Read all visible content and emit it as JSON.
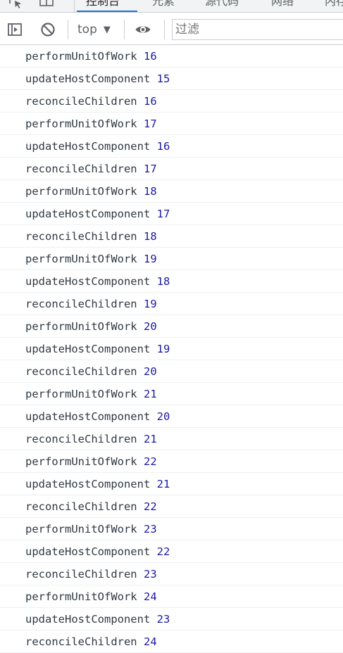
{
  "devtools": {
    "tabs": [
      {
        "label": "控制台",
        "active": true
      },
      {
        "label": "元素",
        "active": false
      },
      {
        "label": "源代码",
        "active": false
      },
      {
        "label": "网络",
        "active": false
      },
      {
        "label": "内存",
        "active": false
      }
    ],
    "toolbar": {
      "context": "top",
      "filter_placeholder": "过滤"
    },
    "colors": {
      "accent": "#1a73e8",
      "number": "#1a1aa6",
      "text": "#303942"
    },
    "icons": [
      "inspect-icon",
      "device-toolbar-icon",
      "sidebar-toggle-icon",
      "clear-console-icon",
      "chevron-down-icon",
      "eye-icon"
    ]
  },
  "console": {
    "messages": [
      {
        "fn": "performUnitOfWork",
        "num": "16"
      },
      {
        "fn": "updateHostComponent",
        "num": "15"
      },
      {
        "fn": "reconcileChildren",
        "num": "16"
      },
      {
        "fn": "performUnitOfWork",
        "num": "17"
      },
      {
        "fn": "updateHostComponent",
        "num": "16"
      },
      {
        "fn": "reconcileChildren",
        "num": "17"
      },
      {
        "fn": "performUnitOfWork",
        "num": "18"
      },
      {
        "fn": "updateHostComponent",
        "num": "17"
      },
      {
        "fn": "reconcileChildren",
        "num": "18"
      },
      {
        "fn": "performUnitOfWork",
        "num": "19"
      },
      {
        "fn": "updateHostComponent",
        "num": "18"
      },
      {
        "fn": "reconcileChildren",
        "num": "19"
      },
      {
        "fn": "performUnitOfWork",
        "num": "20"
      },
      {
        "fn": "updateHostComponent",
        "num": "19"
      },
      {
        "fn": "reconcileChildren",
        "num": "20"
      },
      {
        "fn": "performUnitOfWork",
        "num": "21"
      },
      {
        "fn": "updateHostComponent",
        "num": "20"
      },
      {
        "fn": "reconcileChildren",
        "num": "21"
      },
      {
        "fn": "performUnitOfWork",
        "num": "22"
      },
      {
        "fn": "updateHostComponent",
        "num": "21"
      },
      {
        "fn": "reconcileChildren",
        "num": "22"
      },
      {
        "fn": "performUnitOfWork",
        "num": "23"
      },
      {
        "fn": "updateHostComponent",
        "num": "22"
      },
      {
        "fn": "reconcileChildren",
        "num": "23"
      },
      {
        "fn": "performUnitOfWork",
        "num": "24"
      },
      {
        "fn": "updateHostComponent",
        "num": "23"
      },
      {
        "fn": "reconcileChildren",
        "num": "24"
      }
    ]
  }
}
